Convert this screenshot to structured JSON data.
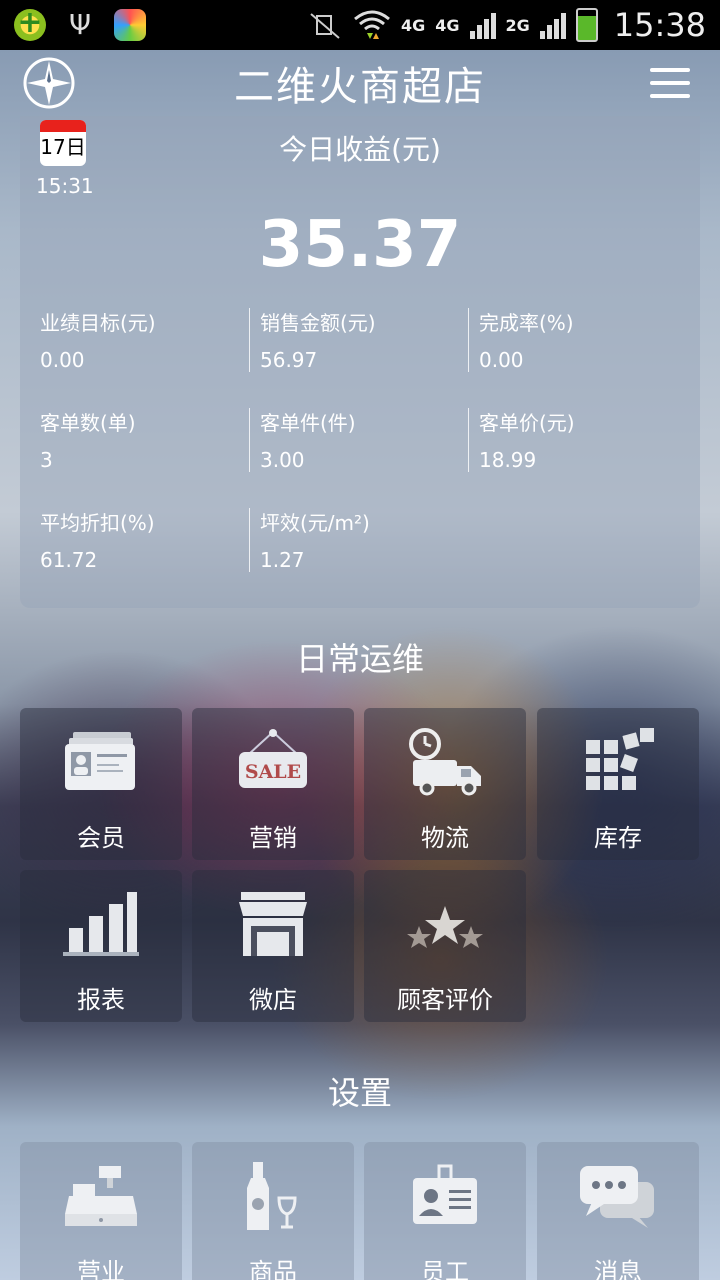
{
  "status_bar": {
    "network_1": "4G",
    "network_2": "4G",
    "network_3": "2G",
    "time": "15:38"
  },
  "header": {
    "title": "二维火商超店",
    "left_icon": "compass-icon",
    "right_icon": "menu-icon"
  },
  "earnings": {
    "calendar_day": "17日",
    "time": "15:31",
    "title": "今日收益(元)",
    "amount": "35.37",
    "stats": [
      {
        "label": "业绩目标(元)",
        "value": "0.00"
      },
      {
        "label": "销售金额(元)",
        "value": "56.97"
      },
      {
        "label": "完成率(%)",
        "value": "0.00"
      },
      {
        "label": "客单数(单)",
        "value": "3"
      },
      {
        "label": "客单件(件)",
        "value": "3.00"
      },
      {
        "label": "客单价(元)",
        "value": "18.99"
      },
      {
        "label": "平均折扣(%)",
        "value": "61.72"
      },
      {
        "label": "坪效(元/m²)",
        "value": "1.27"
      }
    ]
  },
  "daily_ops": {
    "title": "日常运维",
    "items": [
      {
        "label": "会员",
        "icon": "member-card-icon"
      },
      {
        "label": "营销",
        "icon": "sale-sign-icon"
      },
      {
        "label": "物流",
        "icon": "delivery-truck-icon"
      },
      {
        "label": "库存",
        "icon": "inventory-blocks-icon"
      },
      {
        "label": "报表",
        "icon": "bar-chart-icon"
      },
      {
        "label": "微店",
        "icon": "storefront-icon"
      },
      {
        "label": "顾客评价",
        "icon": "stars-icon"
      }
    ]
  },
  "settings": {
    "title": "设置",
    "items": [
      {
        "label": "营业",
        "icon": "cash-register-icon"
      },
      {
        "label": "商品",
        "icon": "wine-bottle-icon"
      },
      {
        "label": "员工",
        "icon": "employee-badge-icon"
      },
      {
        "label": "消息",
        "icon": "chat-bubbles-icon"
      }
    ]
  }
}
